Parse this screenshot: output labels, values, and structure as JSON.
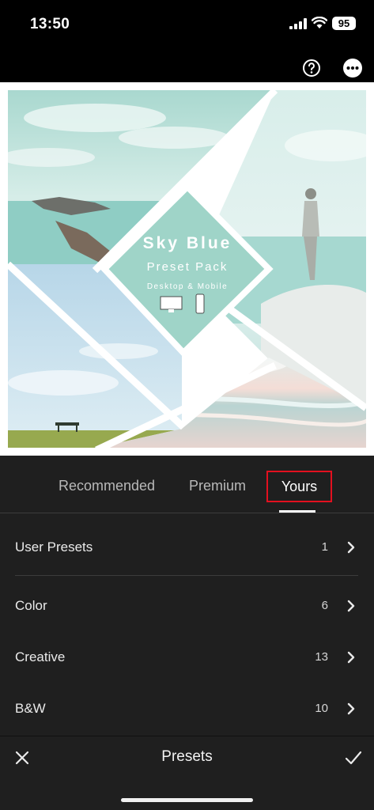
{
  "status": {
    "time": "13:50",
    "battery": "95"
  },
  "preview": {
    "title": "Sky Blue",
    "subtitle": "Preset Pack",
    "caption": "Desktop & Mobile"
  },
  "tabs": [
    {
      "label": "Recommended",
      "selected": false
    },
    {
      "label": "Premium",
      "selected": false
    },
    {
      "label": "Yours",
      "selected": true
    }
  ],
  "preset_groups": [
    {
      "label": "User Presets",
      "count": "1"
    },
    {
      "label": "Color",
      "count": "6"
    },
    {
      "label": "Creative",
      "count": "13"
    },
    {
      "label": "B&W",
      "count": "10"
    }
  ],
  "bottom_bar": {
    "title": "Presets"
  },
  "icons": {
    "help": "help-circle-icon",
    "more": "more-icon",
    "close": "close-icon",
    "confirm": "checkmark-icon",
    "chevron": "chevron-right-icon"
  },
  "colors": {
    "highlight": "#e3101f",
    "panel": "#1f1f1f",
    "accent_teal": "#9fd4c8"
  }
}
